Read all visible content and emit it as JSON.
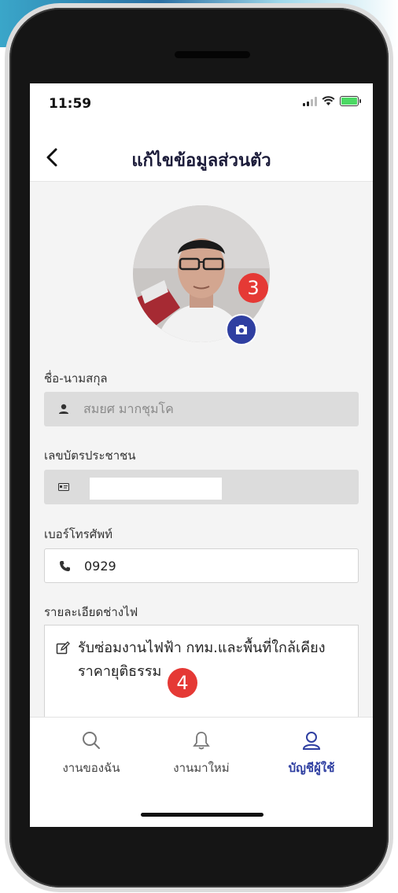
{
  "status": {
    "time": "11:59"
  },
  "header": {
    "title": "แก้ไขข้อมูลส่วนตัว"
  },
  "profile": {
    "badge_avatar": "3",
    "badge_description": "4"
  },
  "form": {
    "name_label": "ชื่อ-นามสกุล",
    "name_value": "สมยศ มากชุมโค",
    "id_label": "เลขบัตรประชาชน",
    "id_value": "",
    "phone_label": "เบอร์โทรศัพท์",
    "phone_value": "0929",
    "desc_label": "รายละเอียดช่างไฟ",
    "desc_line1": "รับซ่อมงานไฟฟ้า กทม.และพื้นที่ใกล้เคียง",
    "desc_line2": "ราคายุติธรรม"
  },
  "tabs": [
    {
      "label": "งานของฉัน",
      "icon": "search-icon"
    },
    {
      "label": "งานมาใหม่",
      "icon": "bell-icon"
    },
    {
      "label": "บัญชีผู้ใช้",
      "icon": "user-icon",
      "active": true
    }
  ],
  "colors": {
    "accent": "#2f3fa1",
    "badge": "#e53935"
  }
}
